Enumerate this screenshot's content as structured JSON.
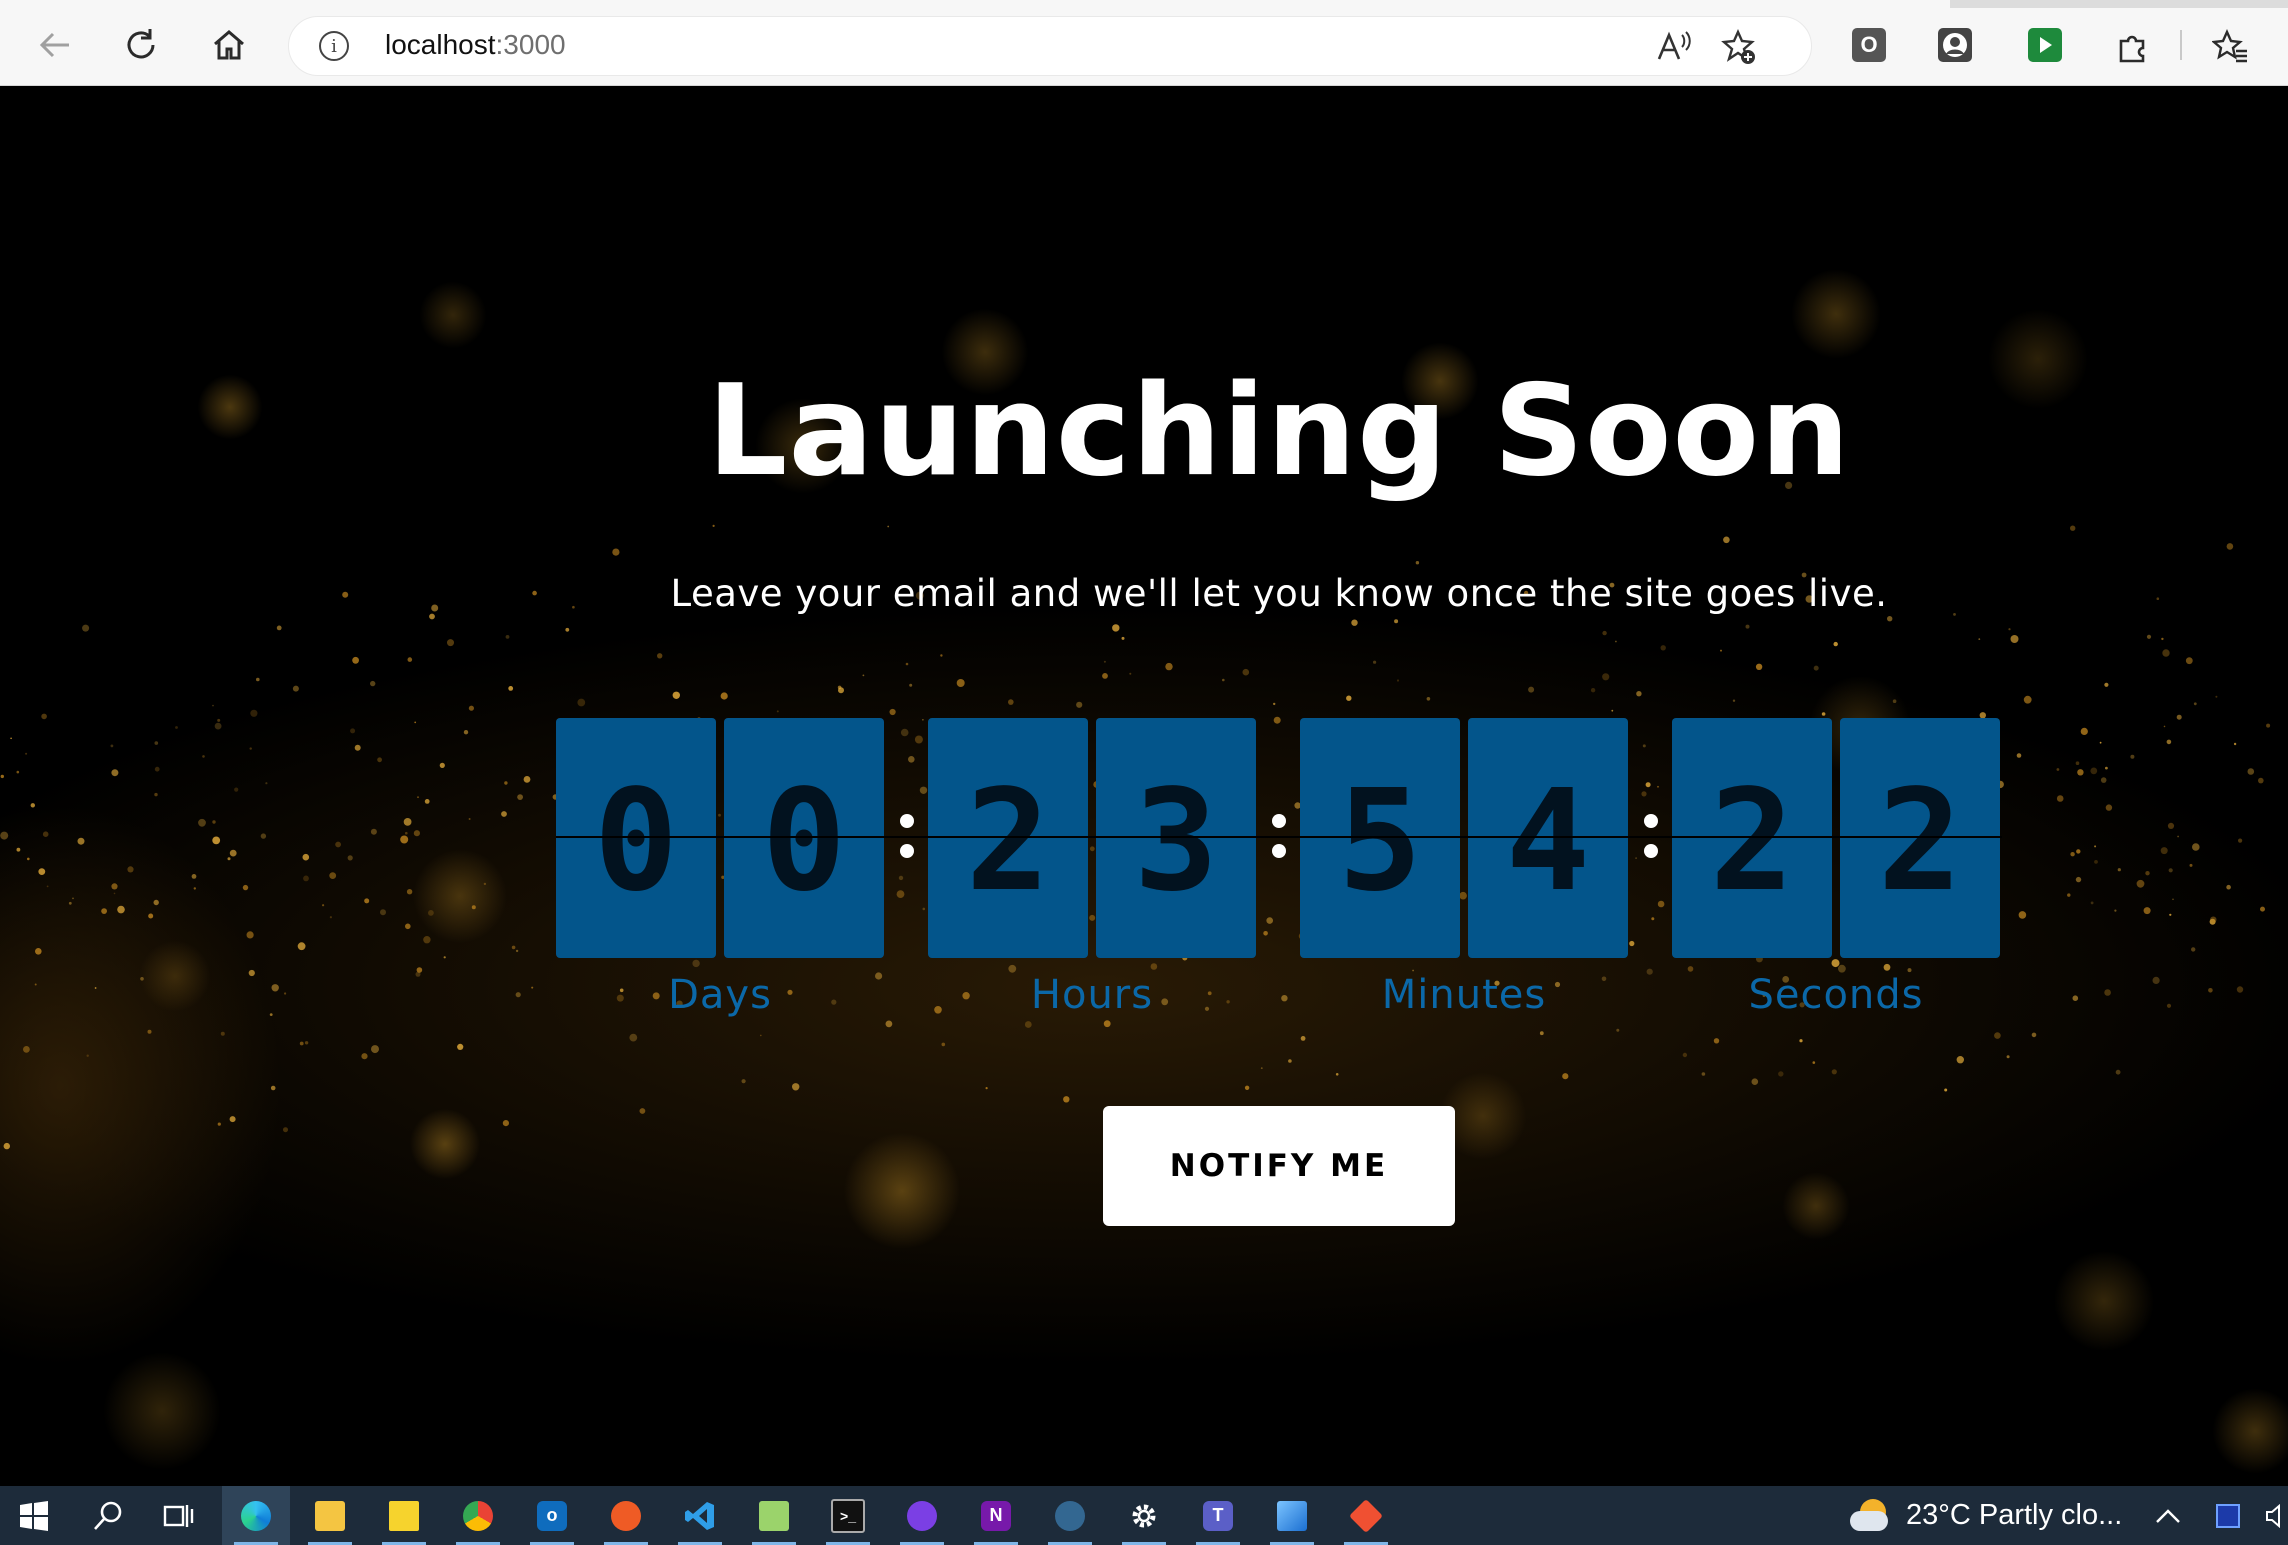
{
  "browser": {
    "url_host": "localhost",
    "url_port": ":3000",
    "icons": [
      "back-icon",
      "refresh-icon",
      "home-icon",
      "info-icon",
      "read-aloud-icon",
      "add-favorite-icon",
      "extensions-icon",
      "favorites-icon"
    ],
    "extension_labels": [
      "O"
    ]
  },
  "page": {
    "title": "Launching Soon",
    "subtitle": "Leave your email and we'll let you know once the site goes live.",
    "countdown": {
      "digits": [
        "0",
        "0",
        "2",
        "3",
        "5",
        "4",
        "2",
        "2"
      ],
      "units": [
        "Days",
        "Hours",
        "Minutes",
        "Seconds"
      ],
      "card_color": "#03558b",
      "label_color": "#0b68a8"
    },
    "notify_button": "NOTIFY ME",
    "background_color": "#000000",
    "accent_glow": "#d19a2a"
  },
  "taskbar": {
    "apps": [
      "windows-start",
      "search",
      "task-view",
      "edge",
      "file-explorer",
      "sticky-notes",
      "chrome",
      "outlook",
      "postman",
      "vscode",
      "notepad-plus-plus",
      "terminal",
      "github-desktop",
      "onenote",
      "pgadmin",
      "settings",
      "teams",
      "photos",
      "git"
    ],
    "weather": "23°C  Partly clo...",
    "background": "#1d2b3a"
  }
}
